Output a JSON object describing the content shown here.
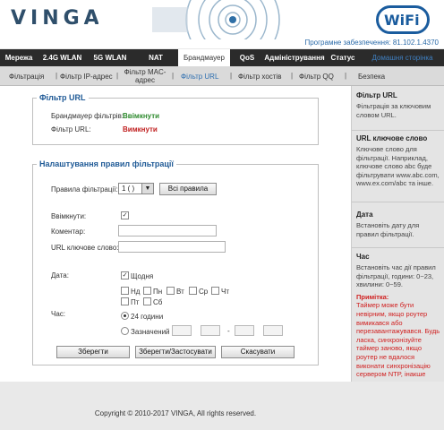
{
  "header": {
    "brand": "VINGA",
    "wifi_logo": "WiFi",
    "firmware": "Програмне забезпечення: 81.102.1.4370"
  },
  "main_nav": [
    {
      "label": "Мережа"
    },
    {
      "label": "2.4G WLAN"
    },
    {
      "label": "5G WLAN"
    },
    {
      "label": "NAT"
    },
    {
      "label": "Брандмауер",
      "active": true
    },
    {
      "label": "QoS"
    },
    {
      "label": "Адміністрування"
    },
    {
      "label": "Статус"
    },
    {
      "label": "Домашня сторінка"
    }
  ],
  "sub_nav": [
    {
      "label": "Фільтрація"
    },
    {
      "label": "Фільтр IP-адрес"
    },
    {
      "label": "Фільтр MAC-адрес"
    },
    {
      "label": "Фільтр URL",
      "active": true
    },
    {
      "label": "Фільтр хостів"
    },
    {
      "label": "Фільтр QQ"
    },
    {
      "label": "Безпека"
    }
  ],
  "url_filter": {
    "legend": "Фільтр URL",
    "firewall_label": "Брандмауер фільтрів:",
    "firewall_value": "Ввімкнути",
    "url_label": "Фільтр URL:",
    "url_value": "Вимкнути"
  },
  "rules": {
    "legend": "Налаштування правил фільтрації",
    "rule_label": "Правила фільтрації:",
    "rule_value": "1 ( )",
    "all_rules_button": "Всі правила",
    "enable_label": "Ввімкнути:",
    "enable_checked": true,
    "comment_label": "Коментар:",
    "comment_value": "",
    "keyword_label": "URL ключове слово:",
    "keyword_value": "",
    "date_label": "Дата:",
    "daily_label": "Щодня",
    "daily_checked": true,
    "days": [
      "Нд",
      "Пн",
      "Вт",
      "Ср",
      "Чт",
      "Пт",
      "Сб"
    ],
    "time_label": "Час:",
    "time_24h": "24 години",
    "time_custom": "Зазначений",
    "time_separator": "-",
    "time_mode": "24h"
  },
  "buttons": {
    "save": "Зберегти",
    "save_apply": "Зберегти/Застосувати",
    "cancel": "Скасувати"
  },
  "help": [
    {
      "title": "Фільтр URL",
      "body": "Фільтрація за ключовим словом URL."
    },
    {
      "title": "URL ключове слово",
      "body": "Ключове слово для фільтрації. Наприклад, ключове слово abc буде фільтрувати www.abc.com, www.ex.com/abc та інше."
    },
    {
      "title": "Дата",
      "body": "Встановіть дату для правил фільтрації."
    },
    {
      "title": "Час",
      "body": "Встановіть час дії правил фільтрації, години: 0~23, хвилини: 0~59."
    }
  ],
  "help_note": {
    "title": "Примітка:",
    "body": "Таймер може бути невірним, якщо роутер вимикався або перезавантажувався. Будь ласка, синхронізуйте таймер заново, якщо роутер не вдалося виконати синхронізацію сервером NTP, інакше контроль часу може не працювати."
  },
  "footer": "Copyright © 2010-2017 VINGA, All rights reserved.",
  "colors": {
    "nav_bg": "#2b2b2b",
    "accent": "#1f5a96",
    "enabled": "#2d8a2d",
    "disabled": "#c02020"
  }
}
